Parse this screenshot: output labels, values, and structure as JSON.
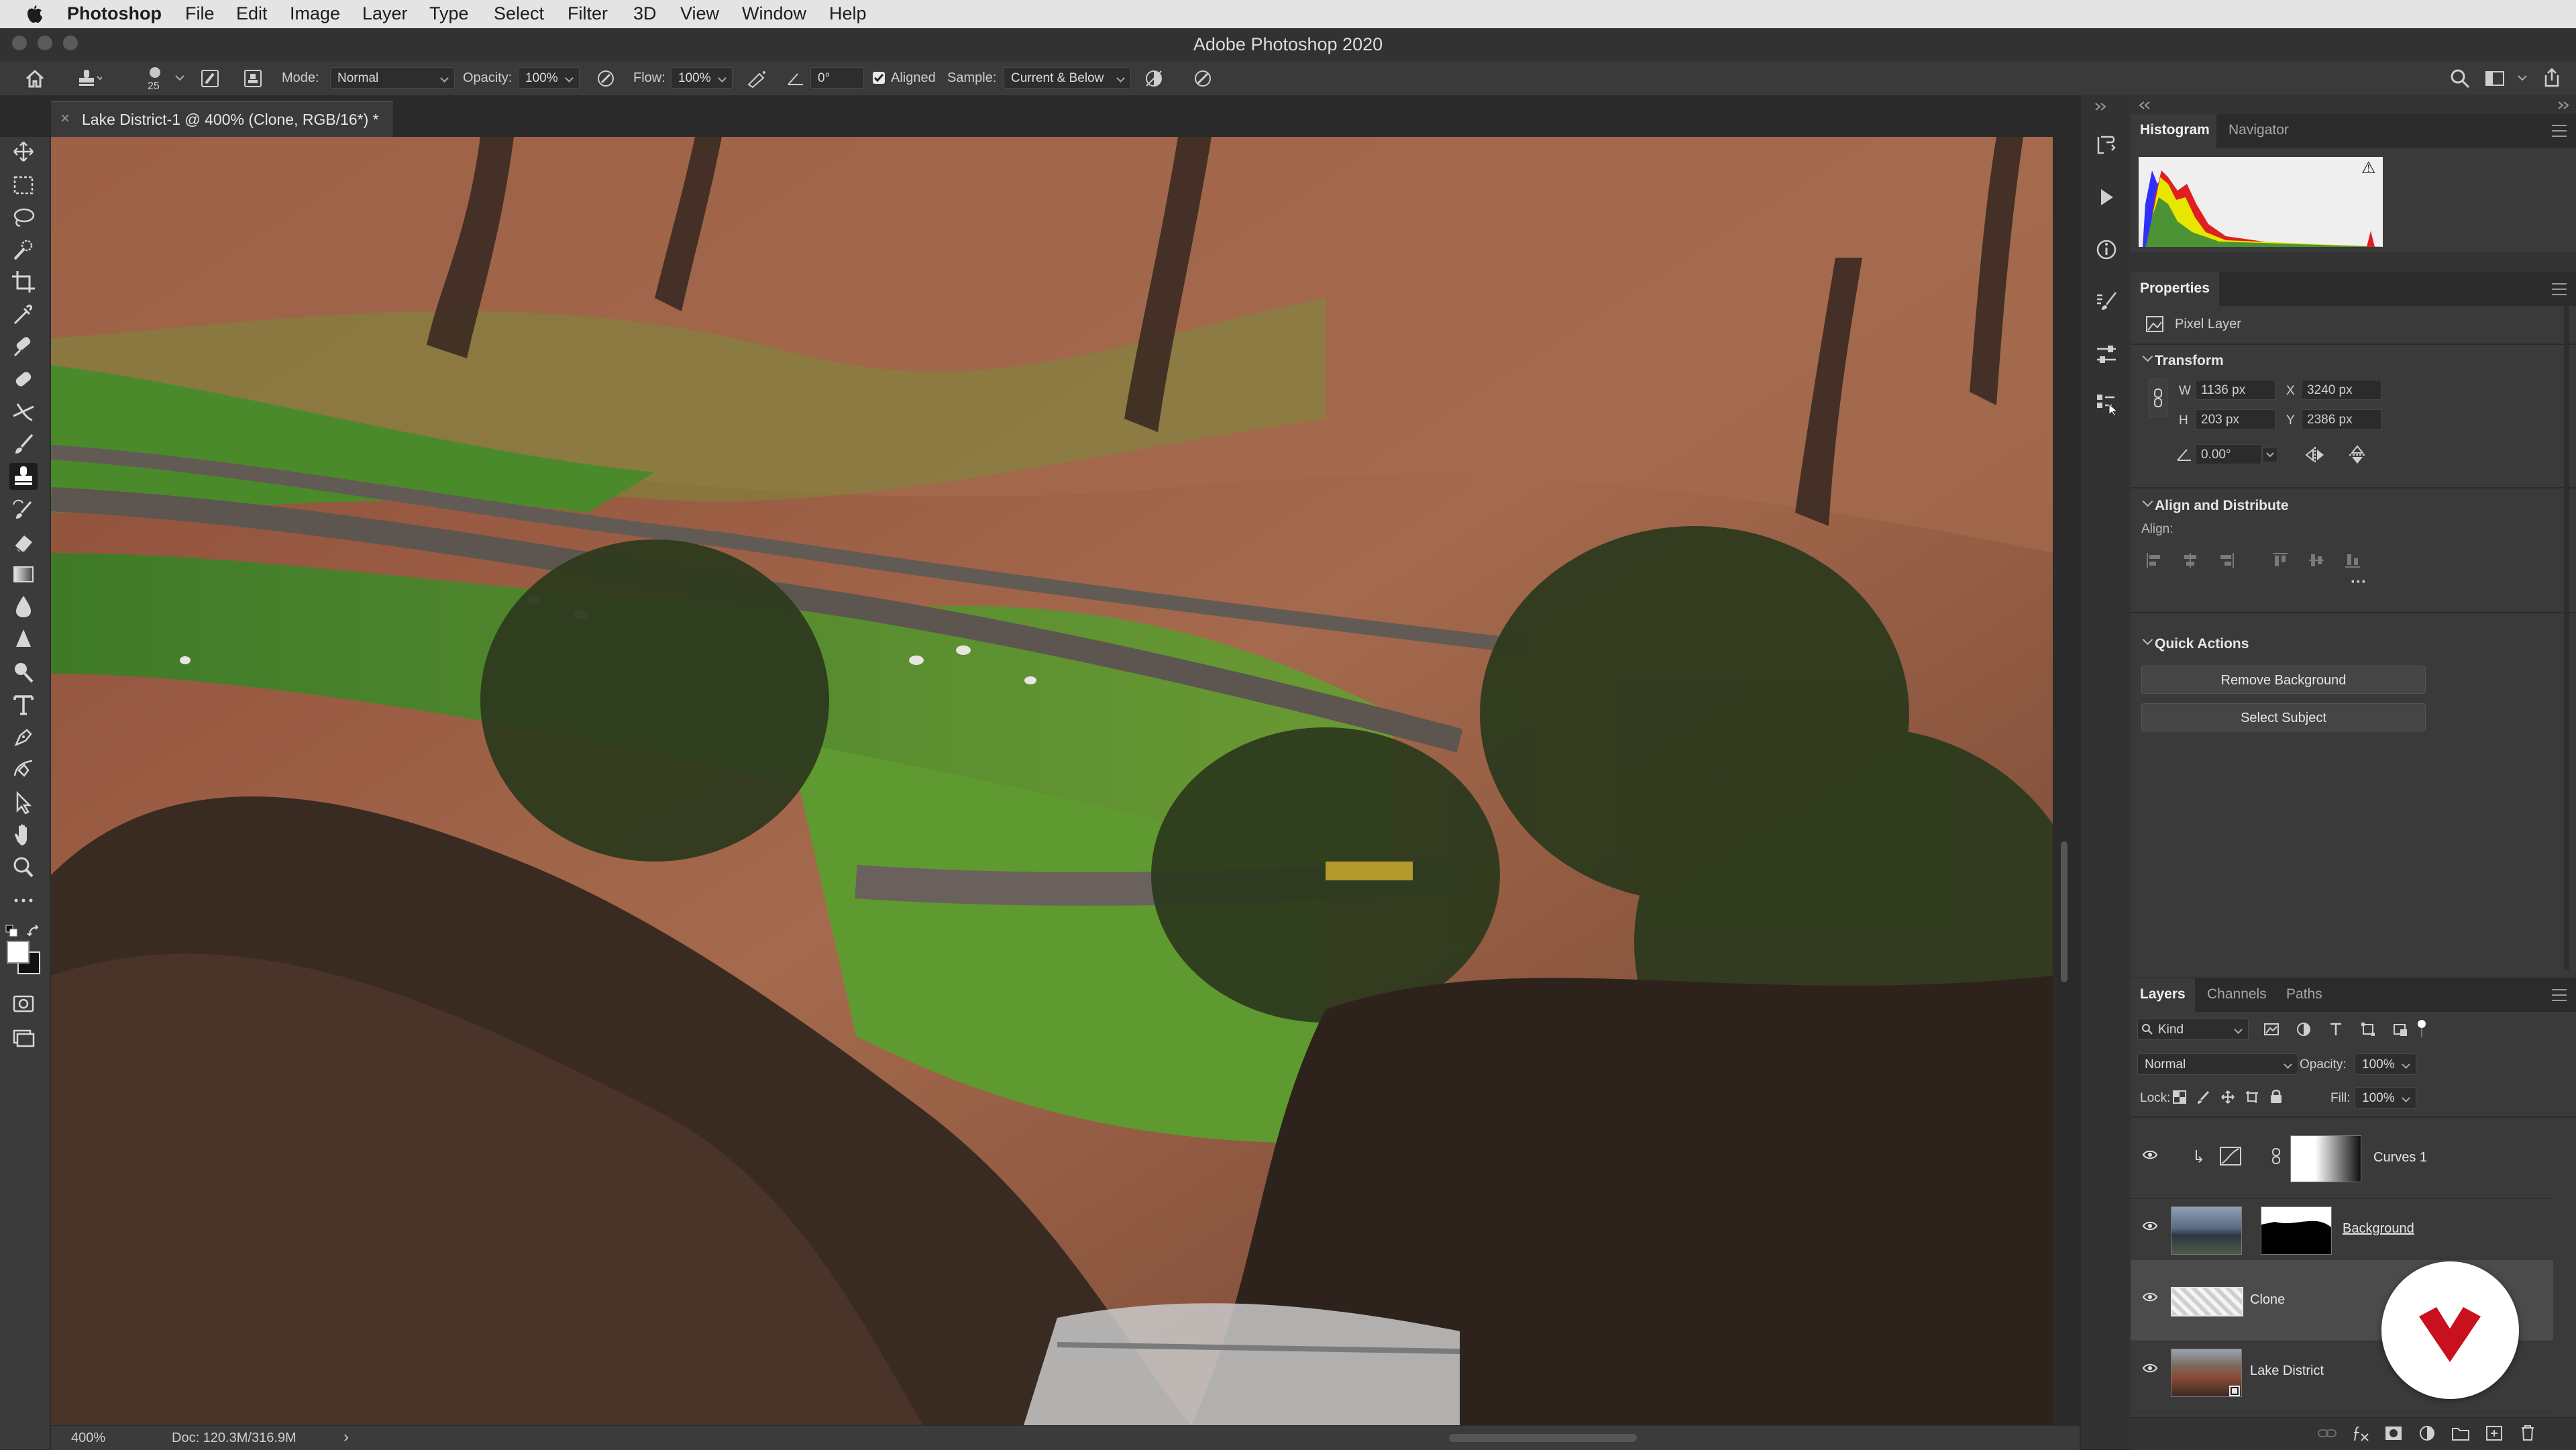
{
  "menubar": {
    "app_name": "Photoshop",
    "items": [
      "File",
      "Edit",
      "Image",
      "Layer",
      "Type",
      "Select",
      "Filter",
      "3D",
      "View",
      "Window",
      "Help"
    ]
  },
  "window": {
    "title": "Adobe Photoshop 2020"
  },
  "options": {
    "brush_size": "25",
    "mode_label": "Mode:",
    "mode_value": "Normal",
    "opacity_label": "Opacity:",
    "opacity_value": "100%",
    "flow_label": "Flow:",
    "flow_value": "100%",
    "angle_value": "0°",
    "aligned_label": "Aligned",
    "aligned_checked": true,
    "sample_label": "Sample:",
    "sample_value": "Current & Below"
  },
  "document": {
    "tab_title": "Lake District-1 @ 400% (Clone, RGB/16*) *",
    "tab_close": "×"
  },
  "status": {
    "zoom": "400%",
    "doc_size": "Doc: 120.3M/316.9M",
    "arrow": "›"
  },
  "panels": {
    "histogram_tab": "Histogram",
    "navigator_tab": "Navigator",
    "histogram_warning": "⚠",
    "properties_tab": "Properties",
    "layer_type": "Pixel Layer",
    "transform": {
      "title": "Transform",
      "w_label": "W",
      "w_value": "1136 px",
      "h_label": "H",
      "h_value": "203 px",
      "x_label": "X",
      "x_value": "3240 px",
      "y_label": "Y",
      "y_value": "2386 px",
      "angle_value": "0.00°"
    },
    "align": {
      "title": "Align and Distribute",
      "label": "Align:",
      "more": "···"
    },
    "quick_actions": {
      "title": "Quick Actions",
      "remove_background": "Remove Background",
      "select_subject": "Select Subject"
    }
  },
  "layers_panel": {
    "tabs": [
      "Layers",
      "Channels",
      "Paths"
    ],
    "filter_kind": "Kind",
    "blend_mode": "Normal",
    "opacity_label": "Opacity:",
    "opacity_value": "100%",
    "lock_label": "Lock:",
    "fill_label": "Fill:",
    "fill_value": "100%",
    "layers": [
      {
        "name": "Curves 1"
      },
      {
        "name": "Background"
      },
      {
        "name": "Clone"
      },
      {
        "name": "Lake District"
      }
    ]
  },
  "colors": {
    "ui_dark": "#262626",
    "panel": "#333333",
    "selected_layer": "#4b4b4b",
    "logo_red": "#c8101e"
  }
}
